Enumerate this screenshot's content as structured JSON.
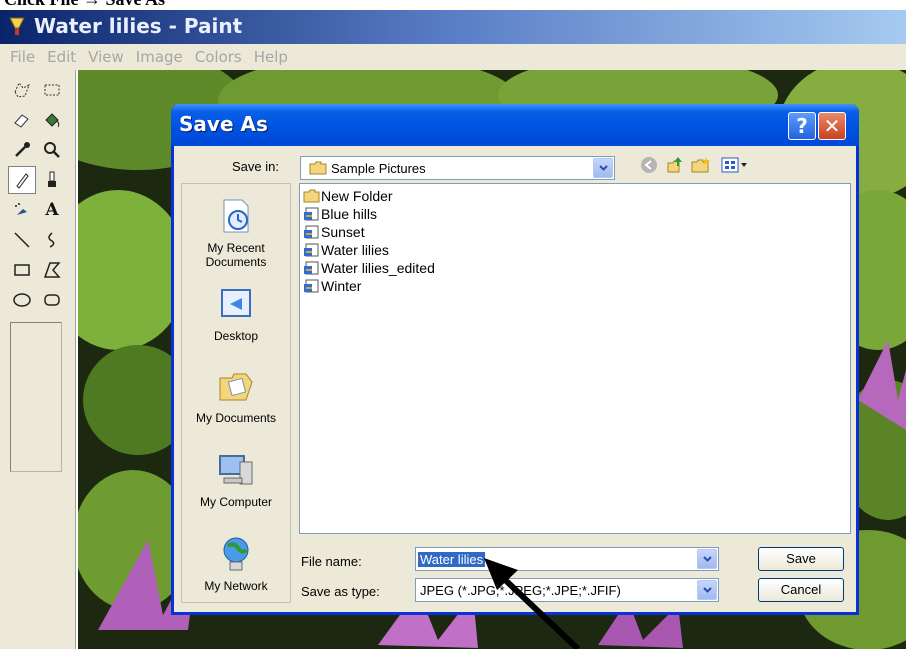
{
  "caption": {
    "text": "Click File → Save As"
  },
  "app": {
    "title": "Water lilies - Paint"
  },
  "menu": {
    "items": [
      "File",
      "Edit",
      "View",
      "Image",
      "Colors",
      "Help"
    ]
  },
  "dialog": {
    "title": "Save As",
    "help_label": "?",
    "close_label": "✕",
    "save_in_label": "Save in:",
    "save_in_value": "Sample Pictures",
    "places": [
      "My Recent\nDocuments",
      "Desktop",
      "My Documents",
      "My Computer",
      "My Network"
    ],
    "files": [
      {
        "name": "New Folder",
        "icon": "folder-icon"
      },
      {
        "name": "Blue hills",
        "icon": "image-file-icon"
      },
      {
        "name": "Sunset",
        "icon": "image-file-icon"
      },
      {
        "name": "Water lilies",
        "icon": "image-file-icon"
      },
      {
        "name": "Water lilies_edited",
        "icon": "image-file-icon"
      },
      {
        "name": "Winter",
        "icon": "image-file-icon"
      }
    ],
    "file_name_label": "File name:",
    "file_name_value": "Water lilies",
    "save_type_label": "Save as type:",
    "save_type_value": "JPEG (*.JPG;*.JPEG;*.JPE;*.JFIF)",
    "save_button": "Save",
    "cancel_button": "Cancel"
  },
  "colors": {
    "title_blue": "#0054e3",
    "selection_blue": "#316ac5",
    "dialog_bg": "#ece9d8"
  }
}
